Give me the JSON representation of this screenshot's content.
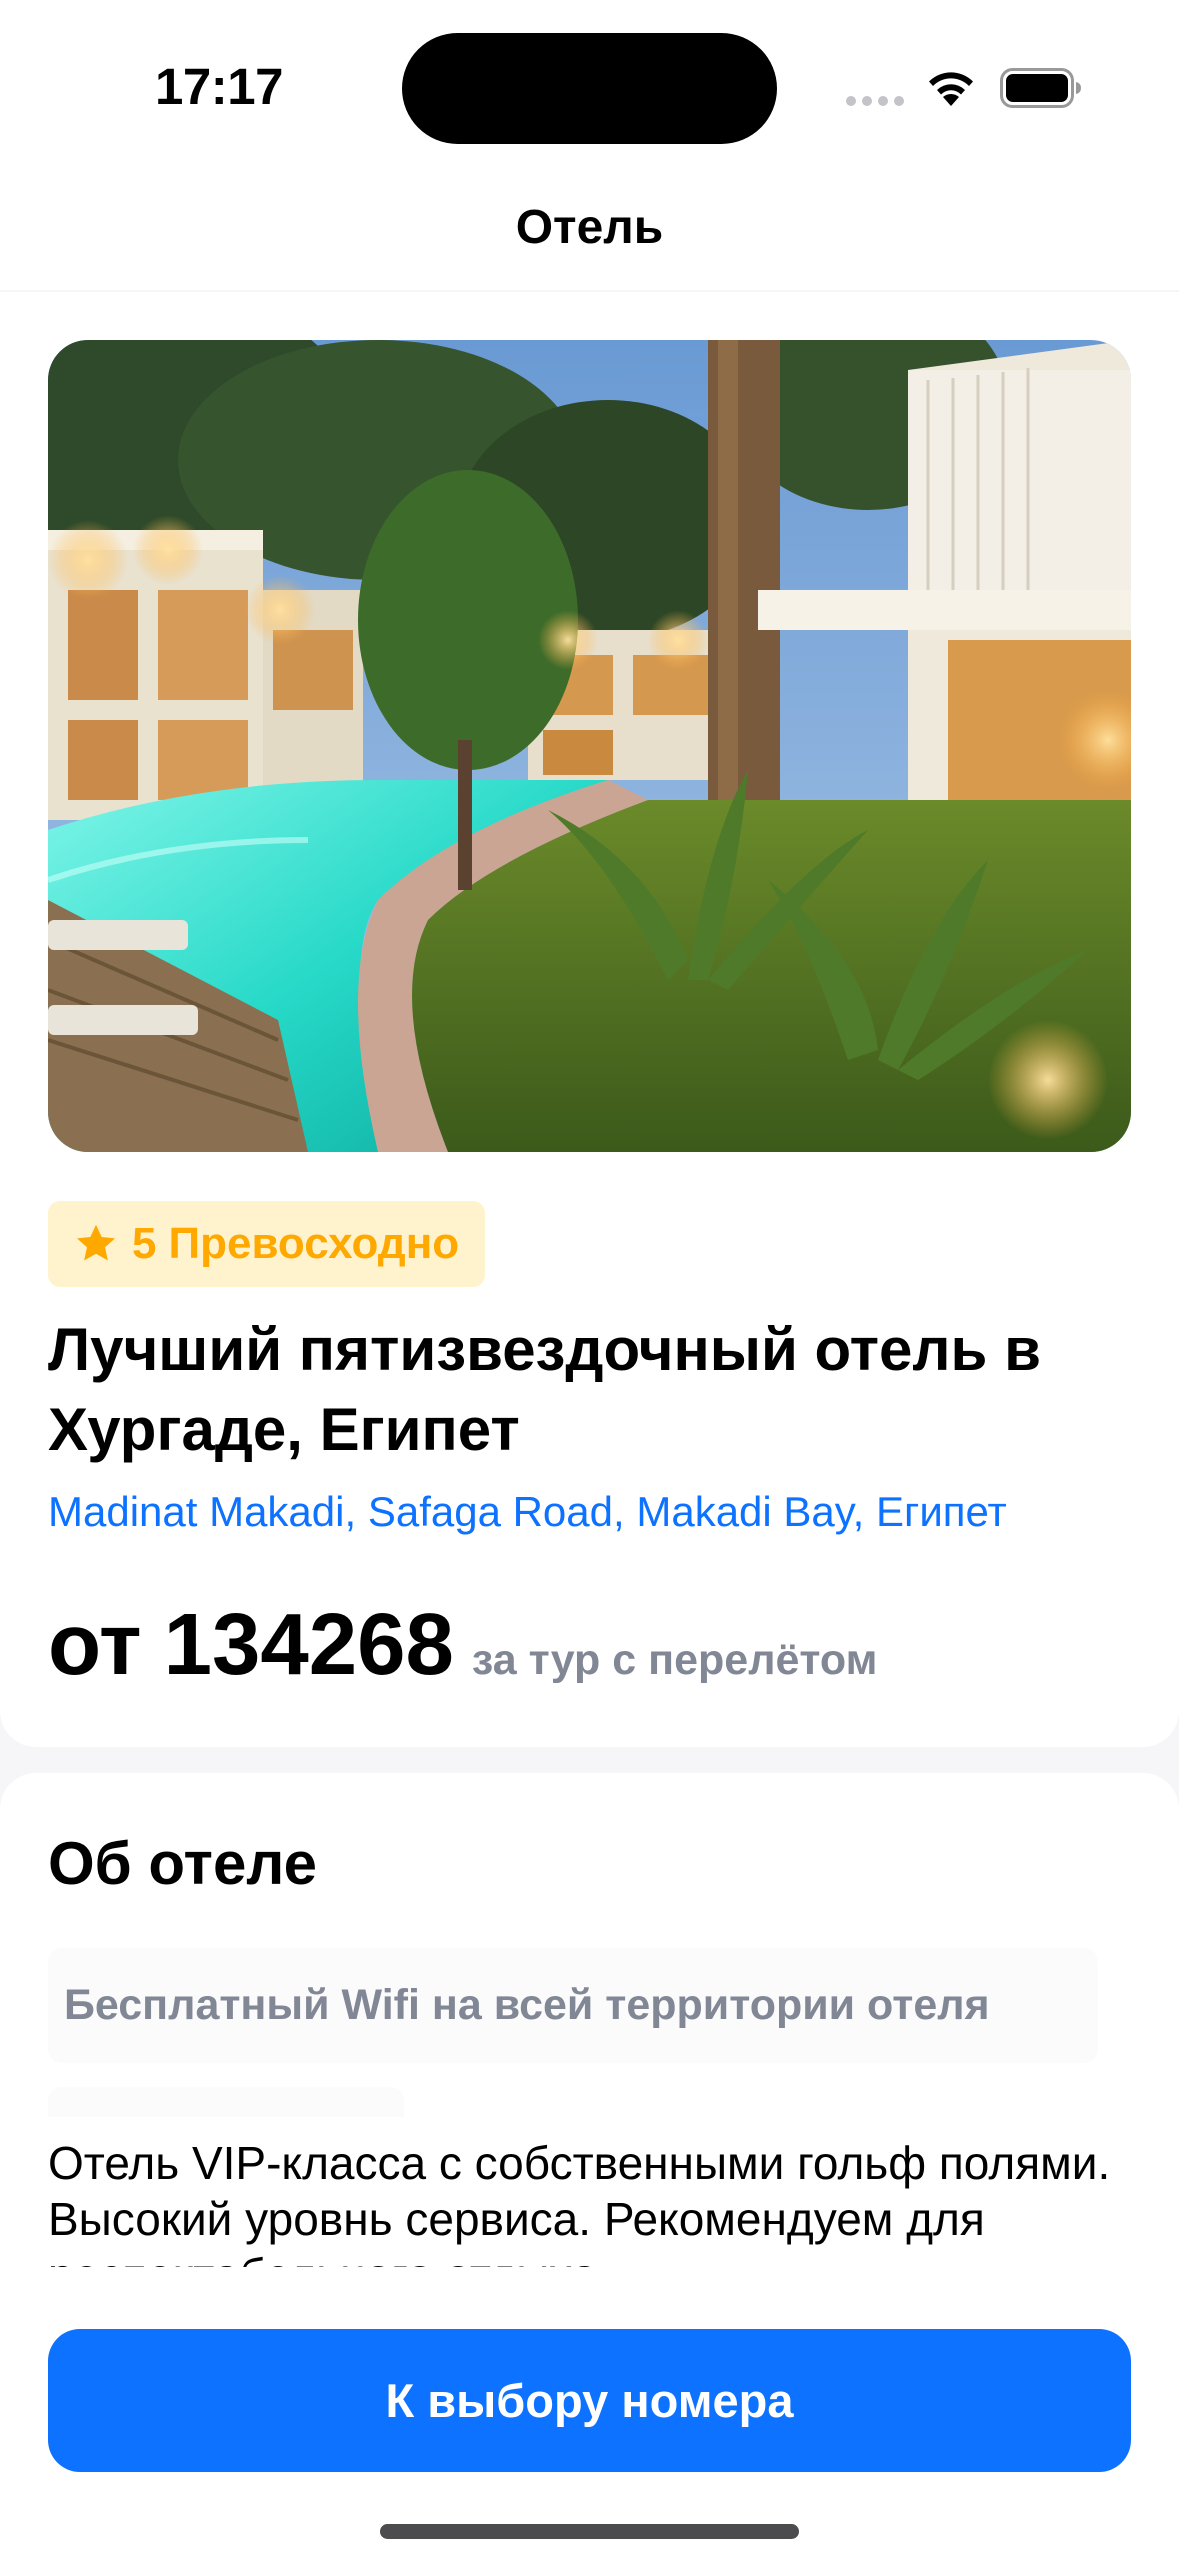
{
  "status_bar": {
    "time": "17:17",
    "icons": [
      "signal-icon",
      "wifi-icon",
      "battery-icon"
    ]
  },
  "nav": {
    "title": "Отель"
  },
  "hotel": {
    "photo": "hotel-pool-evening-photo",
    "rating_value": "5",
    "rating_label": "Превосходно",
    "name": "Лучший пятизвездочный отель в Хургаде, Египет",
    "address": "Madinat Makadi, Safaga Road, Makadi Bay, Египет",
    "price_prefix": "от",
    "price_value": "134268",
    "price_note": "за тур с перелётом"
  },
  "about": {
    "title": "Об отеле",
    "features": [
      "Бесплатный Wifi на всей территории отеля"
    ],
    "description": "Отель VIP-класса с собственными гольф полями. Высокий уровнь сервиса. Рекомендуем для респектабельного отдыха."
  },
  "actions": {
    "primary_button_label": "К выбору номера"
  },
  "colors": {
    "accent": "#0d72ff",
    "rating_text": "#ffa800",
    "rating_bg": "#fff3cd",
    "secondary_text": "#828796",
    "background": "#f6f6f9"
  }
}
